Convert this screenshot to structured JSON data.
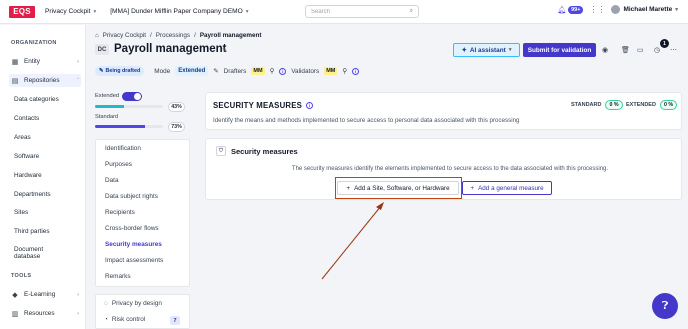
{
  "topbar": {
    "logo": "EQS",
    "app": "Privacy Cockpit",
    "org": "[MMA] Dunder Mifflin Paper Company DEMO",
    "search_placeholder": "Search",
    "notif_count": "99+",
    "user_name": "Michael Marette"
  },
  "sidebar": {
    "organization_title": "ORGANIZATION",
    "entity": "Entity",
    "repositories": "Repositories",
    "repo_items": [
      "Data categories",
      "Contacts",
      "Areas",
      "Software",
      "Hardware",
      "Departments",
      "Sites",
      "Third parties",
      "Document",
      "database"
    ],
    "tools_title": "TOOLS",
    "elearning": "E-Learning",
    "resources": "Resources"
  },
  "breadcrumb": [
    "Privacy Cockpit",
    "/",
    "Processings",
    "/",
    "Payroll management"
  ],
  "header": {
    "code": "DC",
    "title": "Payroll management",
    "ai_label": "AI assistant",
    "submit_label": "Submit for validation",
    "count_badge": "1"
  },
  "status": {
    "draft_label": "Being drafted",
    "mode_label": "Mode",
    "mode_value": "Extended",
    "drafters_label": "Drafters",
    "drafter_initials": "MM",
    "validators_label": "Validators",
    "validator_initials": "MM"
  },
  "progress": {
    "extended_label": "Extended",
    "extended_pct": "43%",
    "standard_label": "Standard",
    "standard_pct": "73%",
    "extended_value": 0.43,
    "standard_value": 0.73
  },
  "steps": [
    "Identification",
    "Purposes",
    "Data",
    "Data subject rights",
    "Recipients",
    "Cross-border flows",
    "Security measures",
    "Impact assessments",
    "Remarks"
  ],
  "steps_active_index": 6,
  "steps2": {
    "privacy": "Privacy by design",
    "risk": "Risk control",
    "risk_count": "7"
  },
  "security_card": {
    "title": "SECURITY MEASURES",
    "description": "Identify the means and methods implemented to secure access to personal data associated with this processing",
    "standard_label": "STANDARD",
    "standard_pct": "0 %",
    "extended_label": "EXTENDED",
    "extended_pct": "0 %"
  },
  "measures_card": {
    "title": "Security measures",
    "description": "The security measures identify the elements implemented to secure access to the data associated with this processing.",
    "add_site_label": "Add a Site, Software, or Hardware",
    "add_general_label": "Add a general measure"
  },
  "colors": {
    "brand": "#e11d48",
    "primary": "#4338ca",
    "extended_bar": "#22b8cf",
    "standard_bar": "#4f46e5",
    "annotation": "#c2410c"
  }
}
